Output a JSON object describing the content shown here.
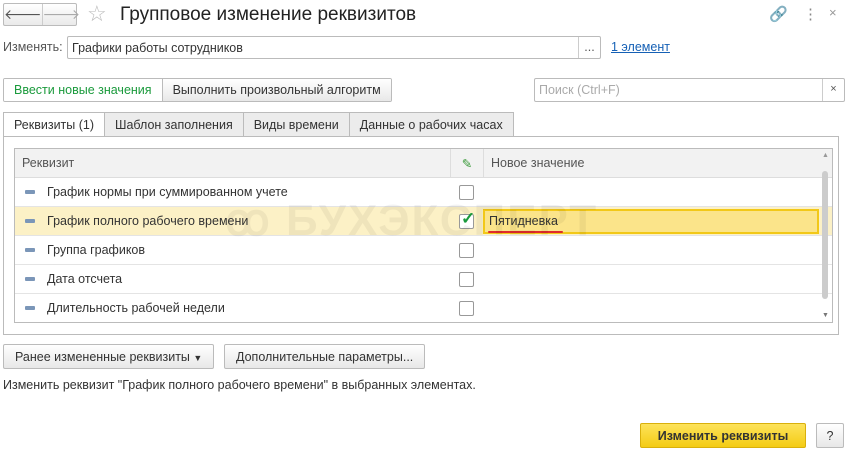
{
  "window": {
    "title": "Групповое изменение реквизитов",
    "back": "🡐",
    "forward": "🡒"
  },
  "change": {
    "label": "Изменять:",
    "value": "Графики работы сотрудников",
    "select_button": "...",
    "elements_link": "1 элемент"
  },
  "toolbar": {
    "enter_values": "Ввести новые значения",
    "run_algorithm": "Выполнить произвольный алгоритм"
  },
  "search": {
    "placeholder": "Поиск (Ctrl+F)",
    "clear": "×"
  },
  "tabs": [
    {
      "label": "Реквизиты (1)"
    },
    {
      "label": "Шаблон заполнения"
    },
    {
      "label": "Виды времени"
    },
    {
      "label": "Данные о рабочих часах"
    }
  ],
  "table": {
    "columns": {
      "attribute": "Реквизит",
      "new_value": "Новое значение"
    },
    "rows": [
      {
        "name": "График нормы при суммированном учете",
        "checked": false,
        "value": ""
      },
      {
        "name": "График полного рабочего времени",
        "checked": true,
        "value": "Пятидневка"
      },
      {
        "name": "Группа графиков",
        "checked": false,
        "value": ""
      },
      {
        "name": "Дата отсчета",
        "checked": false,
        "value": ""
      },
      {
        "name": "Длительность рабочей недели",
        "checked": false,
        "value": ""
      }
    ]
  },
  "watermark": "БУХЭКСПЕРТ",
  "bottom": {
    "prev_changed": "Ранее измененные реквизиты",
    "extra_params": "Дополнительные параметры..."
  },
  "status": "Изменить реквизит \"График полного рабочего времени\" в выбранных элементах.",
  "footer": {
    "apply": "Изменить реквизиты",
    "help": "?"
  },
  "colors": {
    "accent_green": "#1a9a3c",
    "primary_yellow": "#f4cc14",
    "link": "#1560b5"
  }
}
